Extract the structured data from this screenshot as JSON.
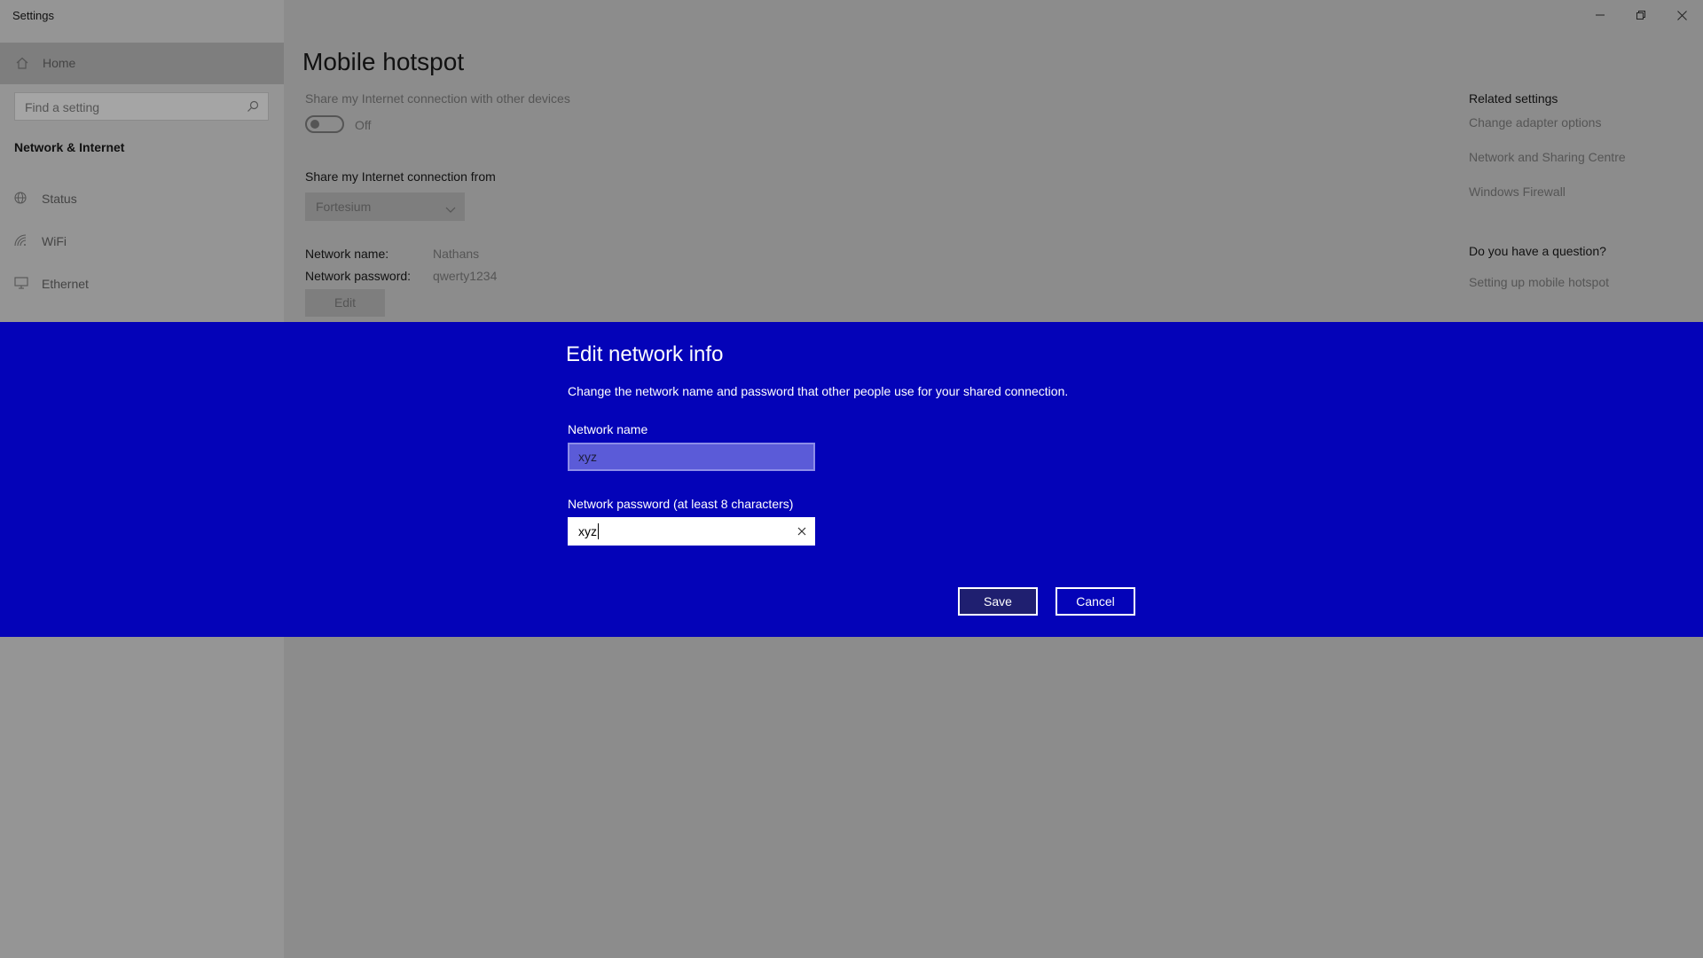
{
  "window": {
    "title": "Settings",
    "controls": [
      "minimize-icon",
      "restore-icon",
      "close-icon"
    ]
  },
  "sidebar": {
    "home_label": "Home",
    "search_placeholder": "Find a setting",
    "section_title": "Network & Internet",
    "items": [
      {
        "label": "Status",
        "icon": "globe-icon"
      },
      {
        "label": "WiFi",
        "icon": "wifi-icon"
      },
      {
        "label": "Ethernet",
        "icon": "ethernet-icon"
      }
    ]
  },
  "main": {
    "title": "Mobile hotspot",
    "share_with_label": "Share my Internet connection with other devices",
    "toggle_state": "Off",
    "share_from_label": "Share my Internet connection from",
    "share_from_value": "Fortesium",
    "network_name_label": "Network name:",
    "network_name_value": "Nathans",
    "network_password_label": "Network password:",
    "network_password_value": "qwerty1234",
    "edit_label": "Edit"
  },
  "related": {
    "heading": "Related settings",
    "links": [
      "Change adapter options",
      "Network and Sharing Centre",
      "Windows Firewall"
    ],
    "question_heading": "Do you have a question?",
    "question_link": "Setting up mobile hotspot"
  },
  "dialog": {
    "title": "Edit network info",
    "description": "Change the network name and password that other people use for your shared connection.",
    "name_label": "Network name",
    "name_value": "xyz",
    "password_label": "Network password (at least 8 characters)",
    "password_value": "xyz",
    "save_label": "Save",
    "cancel_label": "Cancel",
    "background_color": "#0403b8"
  }
}
